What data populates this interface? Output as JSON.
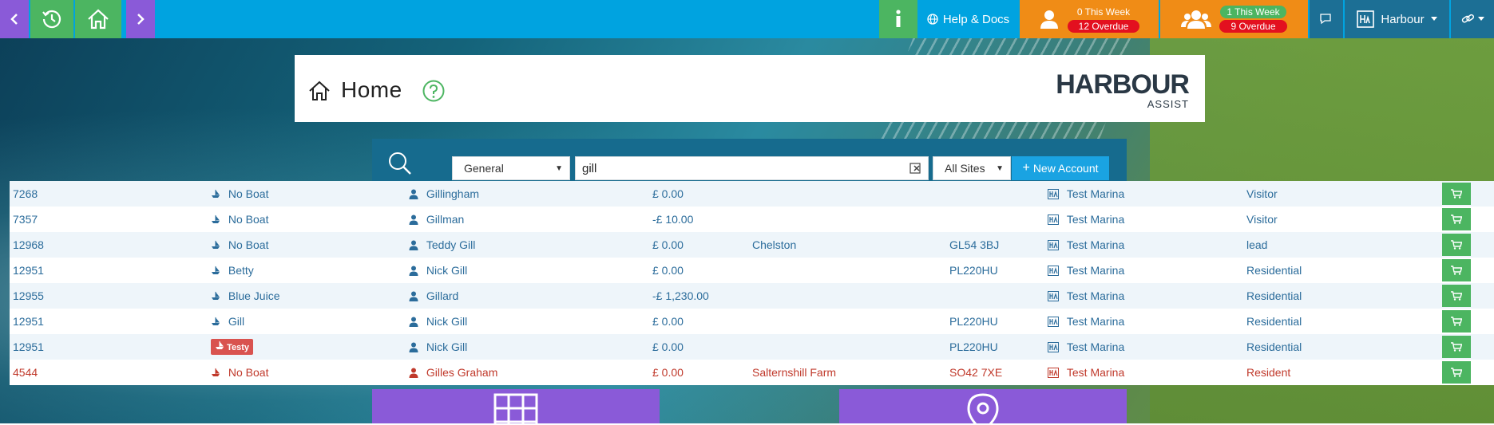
{
  "colors": {
    "topbar": "#00a3e0",
    "purple": "#8a5ad8",
    "green": "#4cb561",
    "orange": "#f08c16",
    "navy": "#1c6f95",
    "overdue": "#e3101f",
    "accent_blue": "#1aa3e2",
    "row_text": "#2b6c9b",
    "alert_text": "#c0392b"
  },
  "topbar": {
    "help_label": "Help & Docs",
    "user_counts": {
      "this_week": "0 This Week",
      "overdue": "12 Overdue"
    },
    "group_counts": {
      "this_week": "1 This Week",
      "overdue": "9 Overdue"
    },
    "harbour_label": "Harbour",
    "icons": [
      "chevron-left-icon",
      "history-icon",
      "home-icon",
      "chevron-right-icon",
      "info-icon",
      "globe-icon",
      "user-icon",
      "users-icon",
      "chat-icon",
      "harbour-badge-icon",
      "caret-down-icon",
      "link-icon"
    ]
  },
  "home": {
    "title": "Home",
    "logo_main": "HARBOUR",
    "logo_sub": "ASSIST"
  },
  "search": {
    "type_selected": "General",
    "query": "gill",
    "site_selected": "All Sites",
    "new_account_label": "New Account"
  },
  "results": [
    {
      "id": "7268",
      "boat": "No Boat",
      "name": "Gillingham",
      "balance": "£ 0.00",
      "town": "",
      "postcode": "",
      "site": "Test Marina",
      "type": "Visitor"
    },
    {
      "id": "7357",
      "boat": "No Boat",
      "name": "Gillman",
      "balance": "-£ 10.00",
      "town": "",
      "postcode": "",
      "site": "Test Marina",
      "type": "Visitor"
    },
    {
      "id": "12968",
      "boat": "No Boat",
      "name": "Teddy Gill",
      "balance": "£ 0.00",
      "town": "Chelston",
      "postcode": "GL54 3BJ",
      "site": "Test Marina",
      "type": "lead"
    },
    {
      "id": "12951",
      "boat": "Betty",
      "name": "Nick Gill",
      "balance": "£ 0.00",
      "town": "",
      "postcode": "PL220HU",
      "site": "Test Marina",
      "type": "Residential"
    },
    {
      "id": "12955",
      "boat": "Blue Juice",
      "name": "Gillard",
      "balance": "-£ 1,230.00",
      "town": "",
      "postcode": "",
      "site": "Test Marina",
      "type": "Residential"
    },
    {
      "id": "12951",
      "boat": "Gill",
      "name": "Nick Gill",
      "balance": "£ 0.00",
      "town": "",
      "postcode": "PL220HU",
      "site": "Test Marina",
      "type": "Residential"
    },
    {
      "id": "12951",
      "boat": "Testy",
      "name": "Nick Gill",
      "balance": "£ 0.00",
      "town": "",
      "postcode": "PL220HU",
      "site": "Test Marina",
      "type": "Residential",
      "boat_badge": true
    },
    {
      "id": "4544",
      "boat": "No Boat",
      "name": "Gilles Graham",
      "balance": "£ 0.00",
      "town": "Salternshill Farm",
      "postcode": "SO42 7XE",
      "site": "Test Marina",
      "type": "Resident",
      "alert": true
    }
  ]
}
